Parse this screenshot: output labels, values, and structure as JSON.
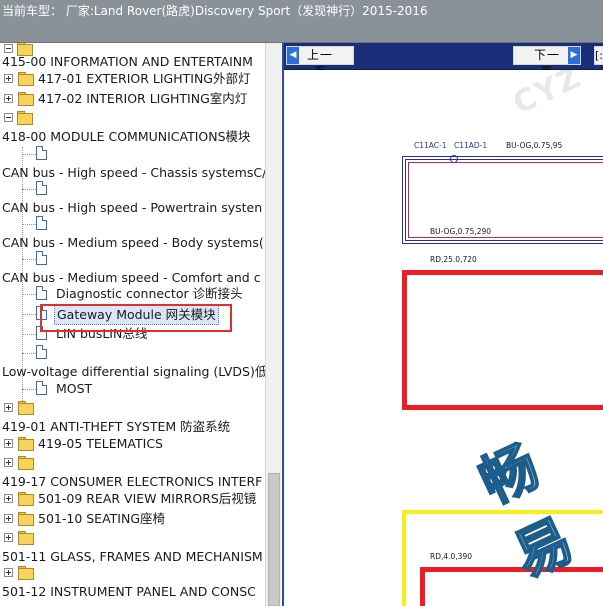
{
  "header": {
    "title": "当前车型：  厂家:Land Rover(路虎)Discovery Sport（发现神行）2015-2016"
  },
  "tree": {
    "items": [
      {
        "label": ""
      },
      {
        "label": "415-00 INFORMATION AND ENTERTAINM"
      },
      {
        "label": "417-01 EXTERIOR LIGHTING外部灯"
      },
      {
        "label": "417-02 INTERIOR LIGHTING室内灯"
      },
      {
        "label": ""
      },
      {
        "label": "418-00 MODULE COMMUNICATIONS模块"
      },
      {
        "label": ""
      },
      {
        "label": "CAN bus - High speed - Chassis systemsC/"
      },
      {
        "label": ""
      },
      {
        "label": "CAN bus - High speed - Powertrain systen"
      },
      {
        "label": ""
      },
      {
        "label": "CAN bus - Medium speed - Body systems("
      },
      {
        "label": ""
      },
      {
        "label": "CAN bus - Medium speed - Comfort and c"
      },
      {
        "label": "Diagnostic connector 诊断接头"
      },
      {
        "label": "Gateway Module 网关模块"
      },
      {
        "label": "LIN busLIN总线"
      },
      {
        "label": ""
      },
      {
        "label": "Low-voltage differential signaling (LVDS)低"
      },
      {
        "label": "MOST"
      },
      {
        "label": ""
      },
      {
        "label": "419-01 ANTI-THEFT SYSTEM 防盗系统"
      },
      {
        "label": "419-05 TELEMATICS"
      },
      {
        "label": ""
      },
      {
        "label": "419-17 CONSUMER ELECTRONICS INTERF"
      },
      {
        "label": "501-09 REAR VIEW MIRRORS后视镜"
      },
      {
        "label": "501-10 SEATING座椅"
      },
      {
        "label": ""
      },
      {
        "label": "501-11 GLASS, FRAMES AND MECHANISM"
      },
      {
        "label": ""
      },
      {
        "label": "501-12 INSTRUMENT PANEL AND CONSC"
      }
    ],
    "selected_label": "Gateway Module 网关模块"
  },
  "viewer": {
    "prev_label": "上一页",
    "next_label": "下一页",
    "extra_label": "[:",
    "watermark_top": "CYZ",
    "watermark_main": "畅易",
    "conn_a": "C11AC-1",
    "conn_b": "C11AD-1",
    "wire1": "BU-OG,0.75,95",
    "wire2": "BU-OG,0.75,290",
    "wire3": "RD,25.0,720",
    "wire4": "RD,4.0,390",
    "colors": {
      "nav_bg": "#1a2f7a",
      "red_wire": "#ee1c24",
      "yellow_wire": "#f7ef19",
      "blue_wire": "#2b2f9a"
    }
  }
}
